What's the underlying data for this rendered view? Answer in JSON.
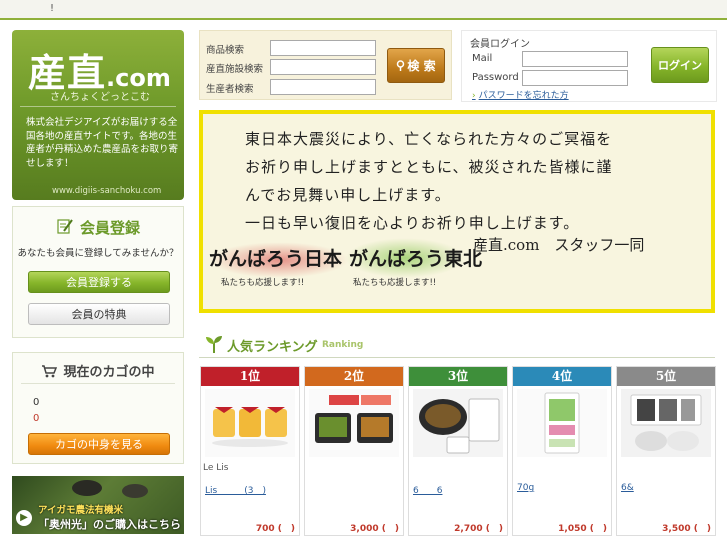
{
  "topbar": {
    "mark": "!"
  },
  "logo": {
    "kanji": "産直",
    "com": ".com",
    "reading": "さんちょくどっとこむ",
    "description": "株式会社デジアイズがお届けする全国各地の産直サイトです。各地の生産者が丹精込めた農産品をお取り寄せします！",
    "url": "www.digiis-sanchoku.com"
  },
  "member": {
    "title": "会員登録",
    "subtitle": "あなたも会員に登録してみませんか？",
    "register_label": "会員登録する",
    "benefits_label": "会員の特典"
  },
  "cart": {
    "title": "現在のカゴの中",
    "items_count": "0",
    "total": "0",
    "view_label": "カゴの中身を見る"
  },
  "promo": {
    "line1": "アイガモ農法有機米",
    "line2": "「奥州光」のご購入はこちら"
  },
  "search": {
    "product_label": "商品検索",
    "facility_label": "産直施設検索",
    "producer_label": "生産者検索",
    "button_label": "検 索"
  },
  "login": {
    "title": "会員ログイン",
    "mail_label": "Mail",
    "password_label": "Password",
    "button_label": "ログイン",
    "forgot_label": "パスワードを忘れた方"
  },
  "banner": {
    "lines": [
      "東日本大震災により、亡くなられた方々のご冥福を",
      "お祈り申し上げますとともに、被災された皆様に謹",
      "んでお見舞い申し上げます。",
      "一日も早い復旧を心よりお祈り申し上げます。"
    ],
    "ganbaro_japan": "がんばろう日本",
    "ganbaro_tohoku": "がんばろう東北",
    "support_text_1": "私たちも応援します!!",
    "support_text_2": "私たちも応援します!!",
    "staff": "産直.com　スタッフ一同"
  },
  "ranking": {
    "title": "人気ランキング",
    "title_en": "Ranking",
    "items": [
      {
        "rank": "1位",
        "color": "#c0202a",
        "sub": "Le Lis",
        "name": "Lis　　　(3　)",
        "price": "700 (　)"
      },
      {
        "rank": "2位",
        "color": "#d2691e",
        "sub": "",
        "name": "",
        "price": "3,000 (　)"
      },
      {
        "rank": "3位",
        "color": "#3e8f3a",
        "sub": "",
        "name": "6　　6",
        "price": "2,700 (　)"
      },
      {
        "rank": "4位",
        "color": "#2b8ab8",
        "sub": "",
        "name": "70g",
        "price": "1,050 (　)"
      },
      {
        "rank": "5位",
        "color": "#8a8a8a",
        "sub": "",
        "name": "6&",
        "price": "3,500 (　)"
      }
    ]
  }
}
